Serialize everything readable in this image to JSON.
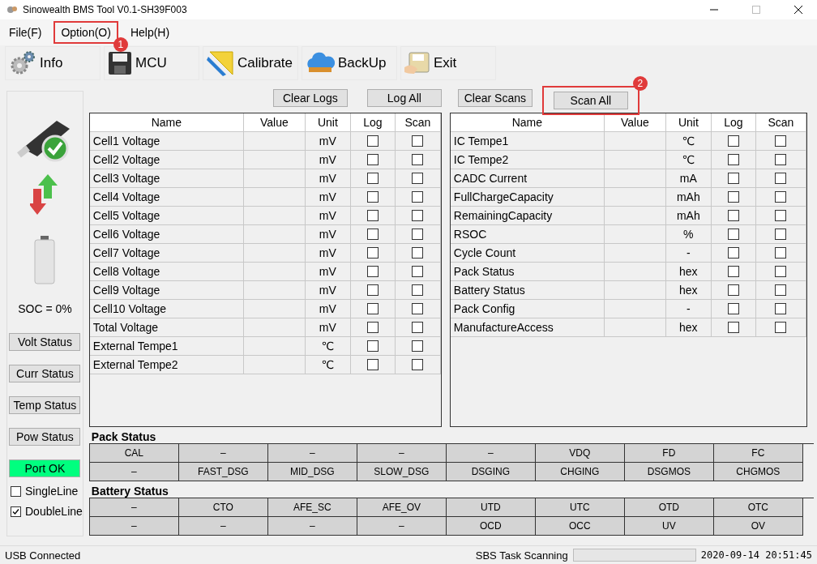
{
  "window": {
    "title": "Sinowealth BMS Tool V0.1-SH39F003"
  },
  "menu": [
    {
      "label": "File(F)"
    },
    {
      "label": "Option(O)",
      "callout": "1"
    },
    {
      "label": "Help(H)"
    }
  ],
  "toolbar": [
    {
      "kind": "gear",
      "label": "Info"
    },
    {
      "kind": "floppy",
      "label": "MCU"
    },
    {
      "kind": "ruler",
      "label": "Calibrate"
    },
    {
      "kind": "cloud",
      "label": "BackUp"
    },
    {
      "kind": "exit",
      "label": "Exit"
    }
  ],
  "sidebar": {
    "soc": "SOC = 0%",
    "buttons": [
      "Volt Status",
      "Curr Status",
      "Temp Status",
      "Pow Status"
    ],
    "port": {
      "label": "Port OK",
      "ok": true
    },
    "options": [
      {
        "label": "SingleLine",
        "checked": false
      },
      {
        "label": "DoubleLine",
        "checked": true
      }
    ]
  },
  "log_buttons": [
    {
      "label": "Clear Logs"
    },
    {
      "label": "Log All"
    }
  ],
  "scan_buttons": [
    {
      "label": "Clear Scans"
    },
    {
      "label": "Scan All",
      "callout": "2"
    }
  ],
  "tables": [
    {
      "columns": [
        "Name",
        "Value",
        "Unit",
        "Log",
        "Scan"
      ],
      "rows": [
        {
          "name": "Cell1 Voltage",
          "unit": "mV",
          "log": false,
          "scan": false
        },
        {
          "name": "Cell2 Voltage",
          "unit": "mV",
          "log": false,
          "scan": false
        },
        {
          "name": "Cell3 Voltage",
          "unit": "mV",
          "log": false,
          "scan": false
        },
        {
          "name": "Cell4 Voltage",
          "unit": "mV",
          "log": false,
          "scan": false
        },
        {
          "name": "Cell5 Voltage",
          "unit": "mV",
          "log": false,
          "scan": false
        },
        {
          "name": "Cell6 Voltage",
          "unit": "mV",
          "log": false,
          "scan": false
        },
        {
          "name": "Cell7 Voltage",
          "unit": "mV",
          "log": false,
          "scan": false
        },
        {
          "name": "Cell8 Voltage",
          "unit": "mV",
          "log": false,
          "scan": false
        },
        {
          "name": "Cell9 Voltage",
          "unit": "mV",
          "log": false,
          "scan": false
        },
        {
          "name": "Cell10 Voltage",
          "unit": "mV",
          "log": false,
          "scan": false
        },
        {
          "name": "Total Voltage",
          "unit": "mV",
          "log": false,
          "scan": false
        },
        {
          "name": "External Tempe1",
          "unit": "℃",
          "log": false,
          "scan": false
        },
        {
          "name": "External Tempe2",
          "unit": "℃",
          "log": false,
          "scan": false
        }
      ]
    },
    {
      "columns": [
        "Name",
        "Value",
        "Unit",
        "Log",
        "Scan"
      ],
      "rows": [
        {
          "name": "IC Tempe1",
          "unit": "℃",
          "log": false,
          "scan": false
        },
        {
          "name": "IC Tempe2",
          "unit": "℃",
          "log": false,
          "scan": false
        },
        {
          "name": "CADC Current",
          "unit": "mA",
          "log": false,
          "scan": false
        },
        {
          "name": "FullChargeCapacity",
          "unit": "mAh",
          "log": false,
          "scan": false
        },
        {
          "name": "RemainingCapacity",
          "unit": "mAh",
          "log": false,
          "scan": false
        },
        {
          "name": "RSOC",
          "unit": "%",
          "log": false,
          "scan": false
        },
        {
          "name": "Cycle Count",
          "unit": "-",
          "log": false,
          "scan": false
        },
        {
          "name": "Pack Status",
          "unit": "hex",
          "log": false,
          "scan": false
        },
        {
          "name": "Battery Status",
          "unit": "hex",
          "log": false,
          "scan": false
        },
        {
          "name": "Pack Config",
          "unit": "-",
          "log": false,
          "scan": false
        },
        {
          "name": "ManufactureAccess",
          "unit": "hex",
          "log": false,
          "scan": false
        }
      ]
    }
  ],
  "status_groups": [
    {
      "title": "Pack Status",
      "rows": [
        [
          "CAL",
          "–",
          "–",
          "–",
          "–",
          "VDQ",
          "FD",
          "FC"
        ],
        [
          "–",
          "FAST_DSG",
          "MID_DSG",
          "SLOW_DSG",
          "DSGING",
          "CHGING",
          "DSGMOS",
          "CHGMOS"
        ]
      ]
    },
    {
      "title": "Battery Status",
      "rows": [
        [
          "–",
          "CTO",
          "AFE_SC",
          "AFE_OV",
          "UTD",
          "UTC",
          "OTD",
          "OTC"
        ],
        [
          "–",
          "–",
          "–",
          "–",
          "OCD",
          "OCC",
          "UV",
          "OV"
        ]
      ]
    }
  ],
  "status_bar": {
    "connection": "USB Connected",
    "task": "SBS Task Scanning",
    "progress": {
      "level": 0
    },
    "datetime": "2020-09-14 20:51:45"
  }
}
